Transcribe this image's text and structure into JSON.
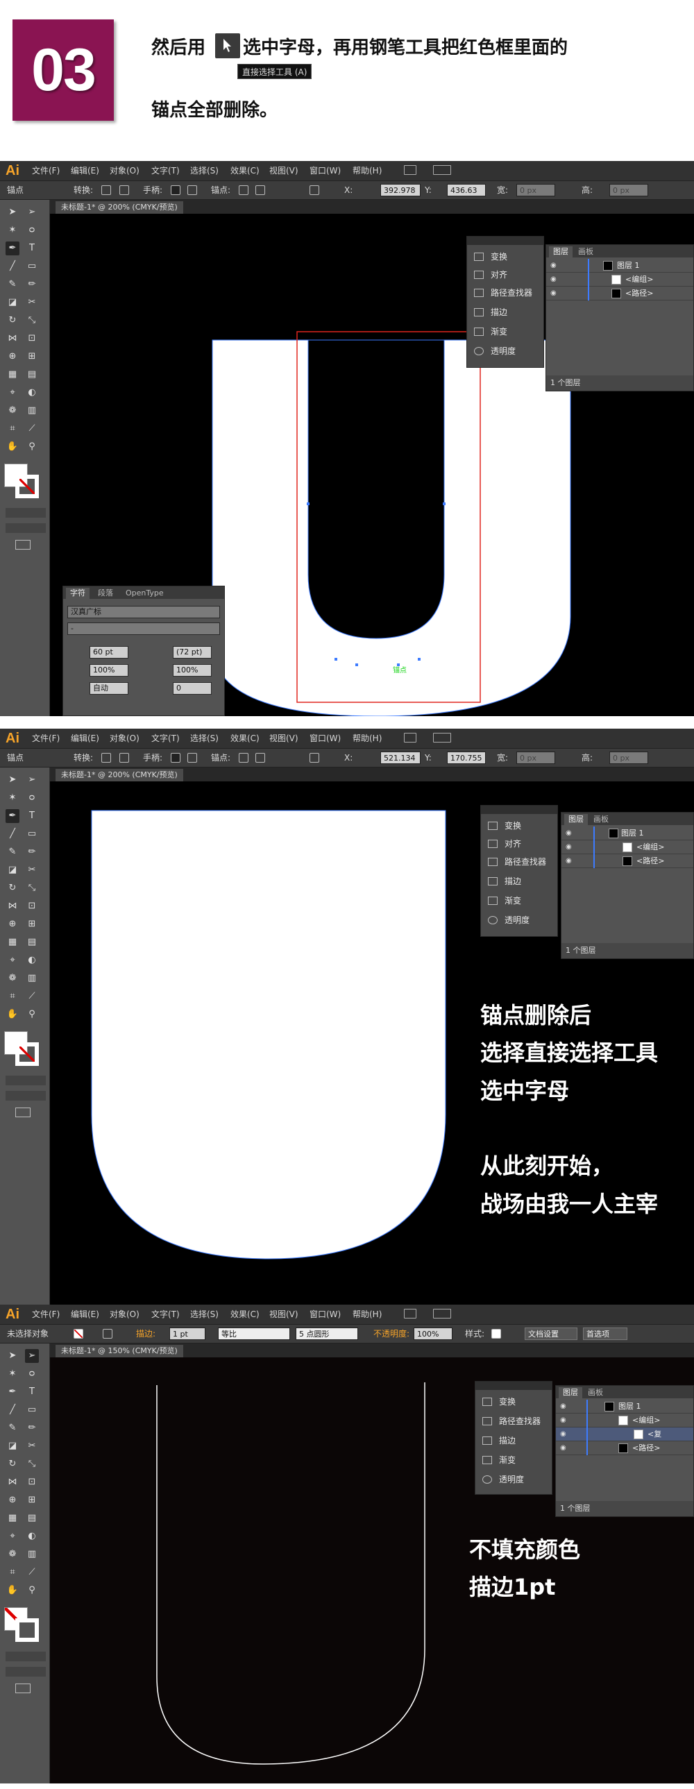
{
  "header": {
    "step_number": "03",
    "line1_before": "然后用",
    "line1_after": "选中字母，再用钢笔工具把红色框里面的",
    "tooltip": "直接选择工具 (A)",
    "line2": "锚点全部删除。"
  },
  "menu": {
    "logo": "Ai",
    "items": [
      "文件(F)",
      "编辑(E)",
      "对象(O)",
      "文字(T)",
      "选择(S)",
      "效果(C)",
      "视图(V)",
      "窗口(W)",
      "帮助(H)"
    ]
  },
  "shot1": {
    "ctrl": {
      "label": "锚点",
      "convert": "转换:",
      "handles": "手柄:",
      "anchors": "锚点:",
      "x": "392.978",
      "y": "436.63",
      "w": "0 px",
      "h": "0 px"
    },
    "doc_tab": "未标题-1* @ 200% (CMYK/预览)",
    "panel_items": [
      "变换",
      "对齐",
      "路径查找器",
      "描边",
      "渐变",
      "透明度"
    ],
    "layers": {
      "tabs": [
        "图层",
        "画板"
      ],
      "layer1": "图层 1",
      "group": "<编组>",
      "path": "<路径>",
      "footer": "1 个图层"
    },
    "char_panel": {
      "tabs": [
        "字符",
        "段落",
        "OpenType"
      ],
      "font": "汉真广标",
      "style": "-",
      "size": "60 pt",
      "leading": "(72 pt)",
      "scale_v": "100%",
      "scale_h": "100%",
      "kerning": "自动",
      "tracking": "0"
    },
    "anchor_label": "锚点"
  },
  "shot2": {
    "ctrl": {
      "label": "锚点",
      "convert": "转换:",
      "handles": "手柄:",
      "anchors": "锚点:",
      "x": "521.134",
      "y": "170.755",
      "w": "0 px",
      "h": "0 px"
    },
    "doc_tab": "未标题-1* @ 200% (CMYK/预览)",
    "panel_items": [
      "变换",
      "对齐",
      "路径查找器",
      "描边",
      "渐变",
      "透明度"
    ],
    "layers": {
      "tabs": [
        "图层",
        "画板"
      ],
      "layer1": "图层 1",
      "group": "<编组>",
      "path": "<路径>",
      "footer": "1 个图层"
    },
    "overlay": [
      "锚点删除后",
      "选择直接选择工具",
      "选中字母",
      "",
      "从此刻开始，",
      "战场由我一人主宰"
    ]
  },
  "shot3": {
    "ctrl": {
      "label": "未选择对象",
      "stroke": "描边:",
      "stroke_w": "1 pt",
      "uniform": "等比",
      "brush": "5 点圆形",
      "opacity": "不透明度:",
      "opacity_v": "100%",
      "style": "样式:",
      "doc_setup": "文档设置",
      "prefs": "首选项"
    },
    "doc_tab": "未标题-1* @ 150% (CMYK/预览)",
    "panel_items": [
      "变换",
      "路径查找器",
      "描边",
      "渐变",
      "透明度"
    ],
    "layers": {
      "tabs": [
        "图层",
        "画板"
      ],
      "layer1": "图层 1",
      "group": "<编组>",
      "sub": "<复",
      "path": "<路径>",
      "footer": "1 个图层"
    },
    "overlay": [
      "不填充颜色",
      "描边1pt"
    ]
  },
  "colors": {
    "badge": "#8a1452",
    "menubar": "#323232",
    "panel": "#535353",
    "selection": "#3d7bff",
    "red_box": "#e0261f"
  }
}
